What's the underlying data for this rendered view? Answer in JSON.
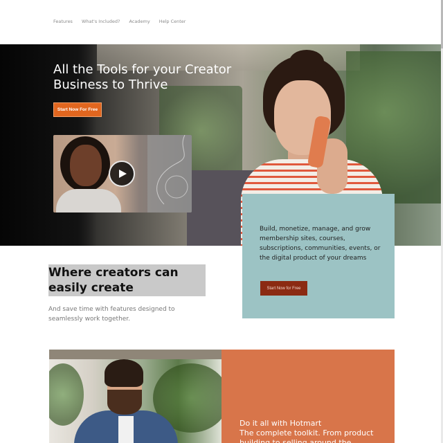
{
  "nav": {
    "items": [
      "Features",
      "What's Included?",
      "Academy",
      "Help Center"
    ]
  },
  "hero": {
    "title": "All the Tools for your Creator Business to Thrive",
    "cta_label": "Start Now For Free",
    "video": {
      "play_icon": "play-icon"
    }
  },
  "intro_card": {
    "text": "Build, monetize, manage, and grow membership sites, courses, subscriptions, communities, events, or the digital product of your dreams",
    "cta_label": "Start Now for Free"
  },
  "section": {
    "headline": "Where creators can easily create",
    "subtext": "And save time with features designed to seamlessly work together."
  },
  "feature_card": {
    "title": "Do it all with Hotmart",
    "text": "The complete toolkit. From product building to selling around the"
  },
  "colors": {
    "hero_cta": "#e1661f",
    "teal_card": "#9cc3c4",
    "card_cta": "#8b2a12",
    "orange_card": "#d8754a"
  }
}
